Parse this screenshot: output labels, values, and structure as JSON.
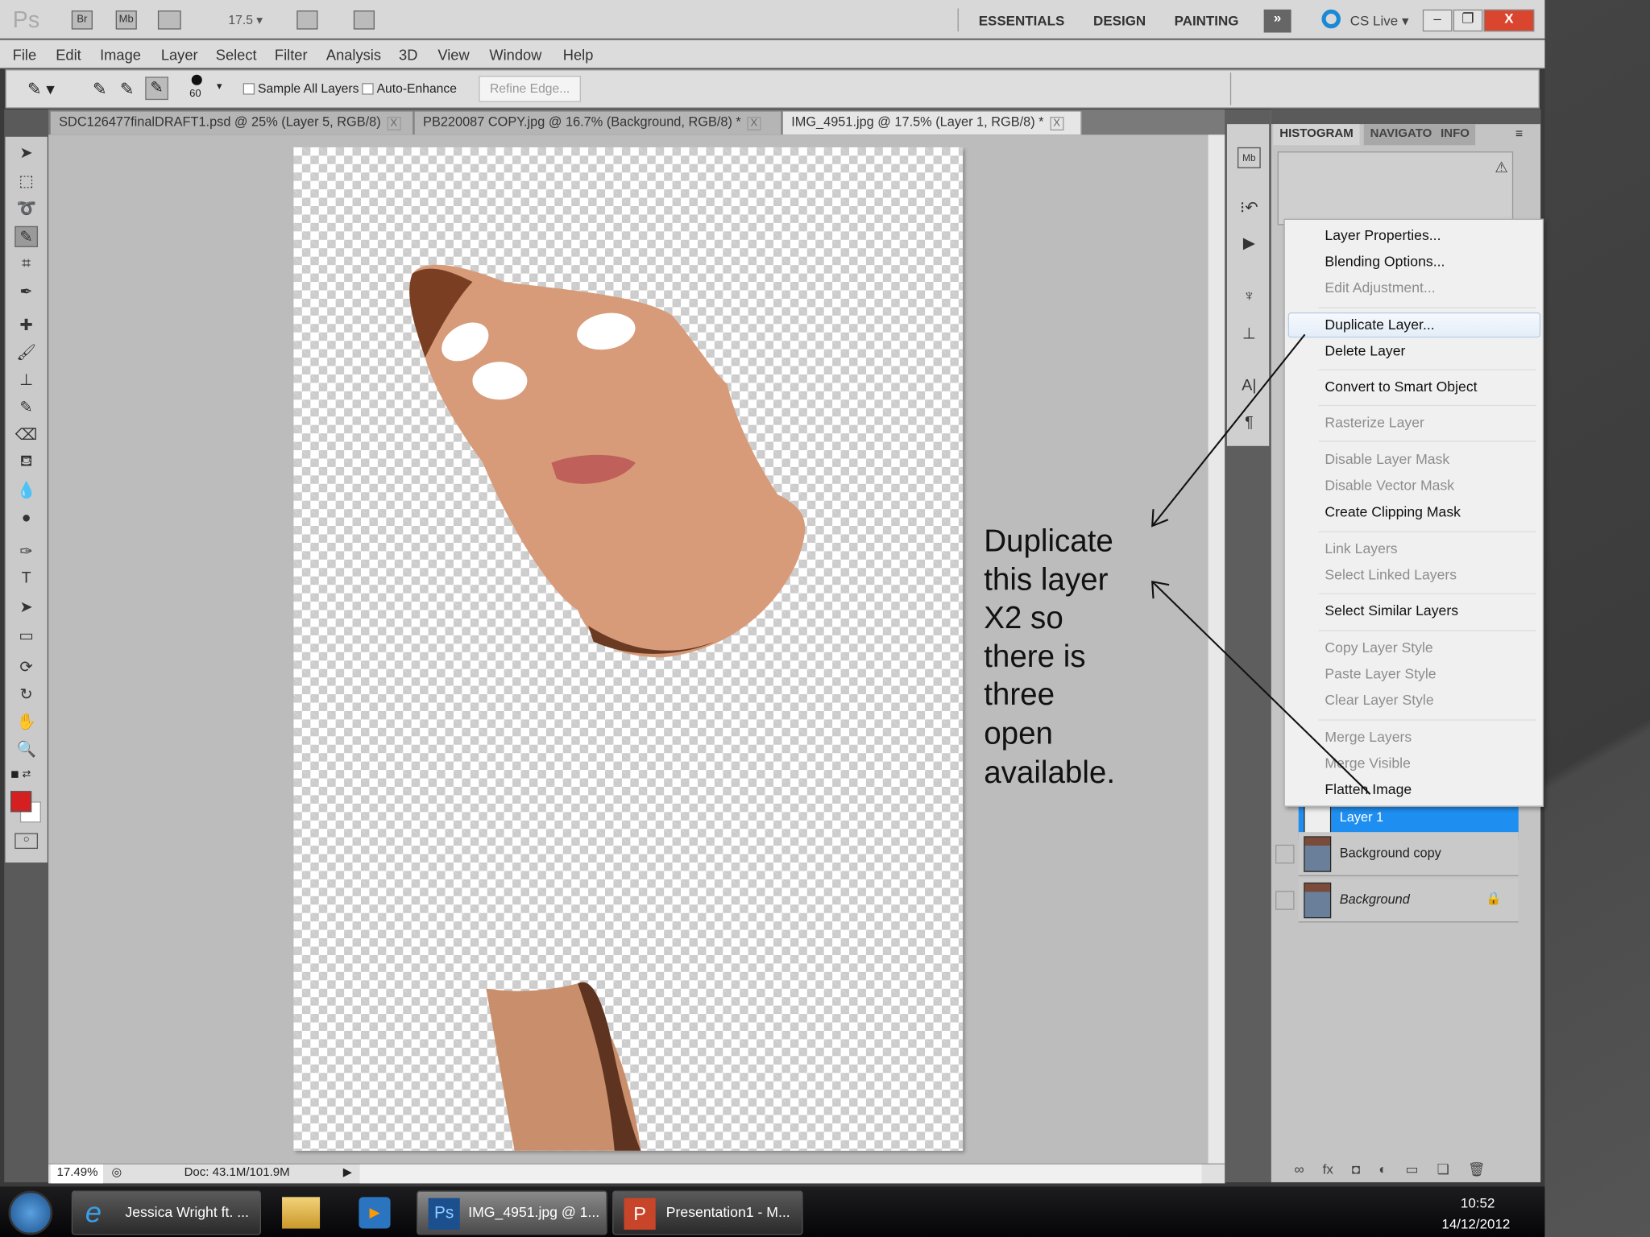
{
  "app": {
    "logo": "Ps",
    "zoom_value": "17.5",
    "bridge_label": "Br",
    "minibridge_label": "Mb"
  },
  "workspaces": [
    "ESSENTIALS",
    "DESIGN",
    "PAINTING"
  ],
  "cs_live": "CS Live",
  "menu_bar": [
    "File",
    "Edit",
    "Image",
    "Layer",
    "Select",
    "Filter",
    "Analysis",
    "3D",
    "View",
    "Window",
    "Help"
  ],
  "options": {
    "brush_size": "60",
    "sample_all_layers": "Sample All Layers",
    "auto_enhance": "Auto-Enhance",
    "refine_edge": "Refine Edge..."
  },
  "doc_tabs": [
    {
      "label": "SDC126477finalDRAFT1.psd @ 25% (Layer 5, RGB/8)",
      "active": false
    },
    {
      "label": "PB220087 COPY.jpg @ 16.7% (Background, RGB/8) *",
      "active": false
    },
    {
      "label": "IMG_4951.jpg @ 17.5% (Layer 1, RGB/8) *",
      "active": true
    }
  ],
  "close_glyph": "X",
  "status": {
    "zoom": "17.49%",
    "doc": "Doc: 43.1M/101.9M"
  },
  "panel_tabs": [
    "HISTOGRAM",
    "NAVIGATO",
    "INFO"
  ],
  "context_menu": [
    {
      "label": "Layer Properties...",
      "enabled": true
    },
    {
      "label": "Blending Options...",
      "enabled": true
    },
    {
      "label": "Edit Adjustment...",
      "enabled": false
    },
    {
      "label": "Duplicate Layer...",
      "enabled": true,
      "highlighted": true
    },
    {
      "label": "Delete Layer",
      "enabled": true
    },
    {
      "label": "Convert to Smart Object",
      "enabled": true
    },
    {
      "label": "Rasterize Layer",
      "enabled": false
    },
    {
      "label": "Disable Layer Mask",
      "enabled": false
    },
    {
      "label": "Disable Vector Mask",
      "enabled": false
    },
    {
      "label": "Create Clipping Mask",
      "enabled": true
    },
    {
      "label": "Link Layers",
      "enabled": false
    },
    {
      "label": "Select Linked Layers",
      "enabled": false
    },
    {
      "label": "Select Similar Layers",
      "enabled": true
    },
    {
      "label": "Copy Layer Style",
      "enabled": false
    },
    {
      "label": "Paste Layer Style",
      "enabled": false
    },
    {
      "label": "Clear Layer Style",
      "enabled": false
    },
    {
      "label": "Merge Layers",
      "enabled": false
    },
    {
      "label": "Merge Visible",
      "enabled": false
    },
    {
      "label": "Flatten Image",
      "enabled": true
    }
  ],
  "layers": [
    {
      "name": "Layer 1",
      "selected": true
    },
    {
      "name": "Background copy",
      "selected": false
    },
    {
      "name": "Background",
      "selected": false,
      "locked": true
    }
  ],
  "annotation": [
    "Duplicate",
    "this layer",
    "X2 so",
    "there is",
    "three",
    "open",
    "available."
  ],
  "taskbar": {
    "items": [
      "Jessica Wright ft. ...",
      "IMG_4951.jpg @ 1...",
      "Presentation1 - M..."
    ],
    "time": "10:52",
    "date": "14/12/2012"
  },
  "colors": {
    "foreground": "#d42020",
    "selection": "#1e90ff",
    "close_button": "#d9452f"
  }
}
